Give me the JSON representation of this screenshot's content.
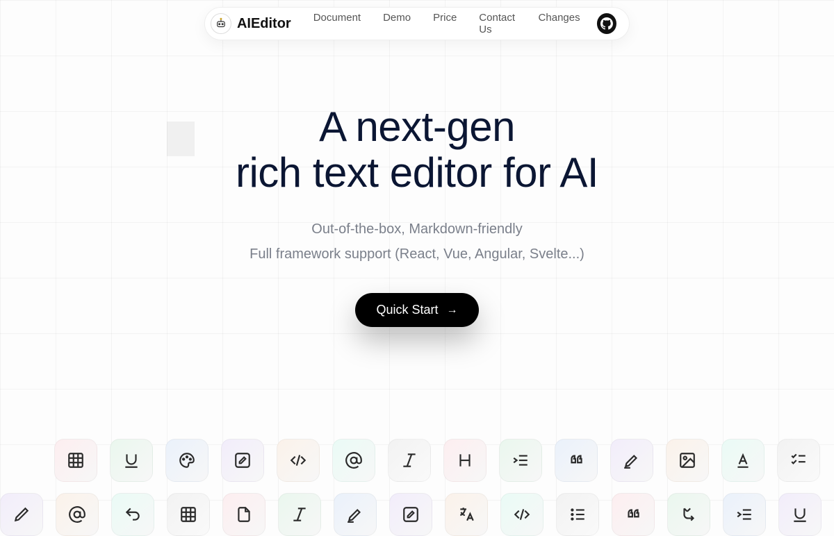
{
  "brand": {
    "name": "AIEditor"
  },
  "nav": {
    "items": [
      {
        "label": "Document"
      },
      {
        "label": "Demo"
      },
      {
        "label": "Price"
      },
      {
        "label": "Contact Us"
      },
      {
        "label": "Changes"
      }
    ]
  },
  "hero": {
    "title_line1": "A next-gen",
    "title_line2": "rich text editor for AI",
    "subtitle_line1": "Out-of-the-box, Markdown-friendly",
    "subtitle_line2": "Full framework support (React, Vue, Angular, Svelte...)",
    "cta_label": "Quick Start"
  },
  "toolstrip_row1": [
    "table",
    "underline",
    "palette",
    "edit",
    "code",
    "mention",
    "italic",
    "heading",
    "indent",
    "quote",
    "highlighter",
    "image",
    "font-color",
    "checklist"
  ],
  "toolstrip_row2": [
    "pencil",
    "mention",
    "undo",
    "table",
    "file",
    "italic",
    "highlighter",
    "edit",
    "translate",
    "code",
    "bullet-list",
    "quote",
    "line-break",
    "indent",
    "underline"
  ]
}
